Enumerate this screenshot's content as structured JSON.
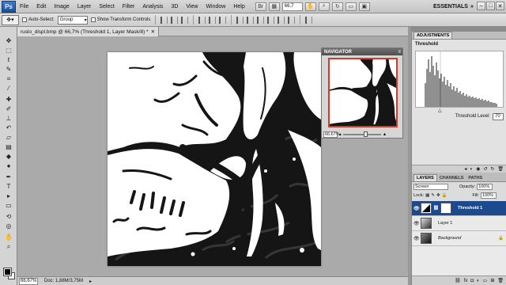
{
  "app": {
    "logo": "Ps",
    "zoom": "66,7"
  },
  "menu": {
    "items": [
      "File",
      "Edit",
      "Image",
      "Layer",
      "Select",
      "Filter",
      "Analysis",
      "3D",
      "View",
      "Window",
      "Help"
    ]
  },
  "workspace": {
    "label": "ESSENTIALS"
  },
  "options": {
    "auto_select_label": "Auto-Select:",
    "group_value": "Group",
    "transform_label": "Show Transform Controls"
  },
  "document": {
    "tab_title": "ruslo_displ.bmp @ 66,7% (Threshold 1, Layer Mask/8) *",
    "status_zoom": "66,67%",
    "doc_size": "Doc: 1,88M/3,75M"
  },
  "navigator": {
    "title": "NAVIGATOR",
    "zoom": "66,67%"
  },
  "adjustments": {
    "tab": "ADJUSTMENTS",
    "header": "Threshold",
    "level_label": "Threshold Level:",
    "level_value": "70"
  },
  "layers_panel": {
    "tabs": [
      "LAYERS",
      "CHANNELS",
      "PATHS"
    ],
    "blend_mode": "Screen",
    "opacity_label": "Opacity:",
    "opacity_value": "100%",
    "lock_label": "Lock:",
    "fill_label": "Fill:",
    "fill_value": "100%",
    "layers": [
      {
        "name": "Threshold 1"
      },
      {
        "name": "Layer 1"
      },
      {
        "name": "Background"
      }
    ]
  },
  "colors": {
    "accent": "#1d4a8f",
    "nav_box": "#d43a2a"
  }
}
